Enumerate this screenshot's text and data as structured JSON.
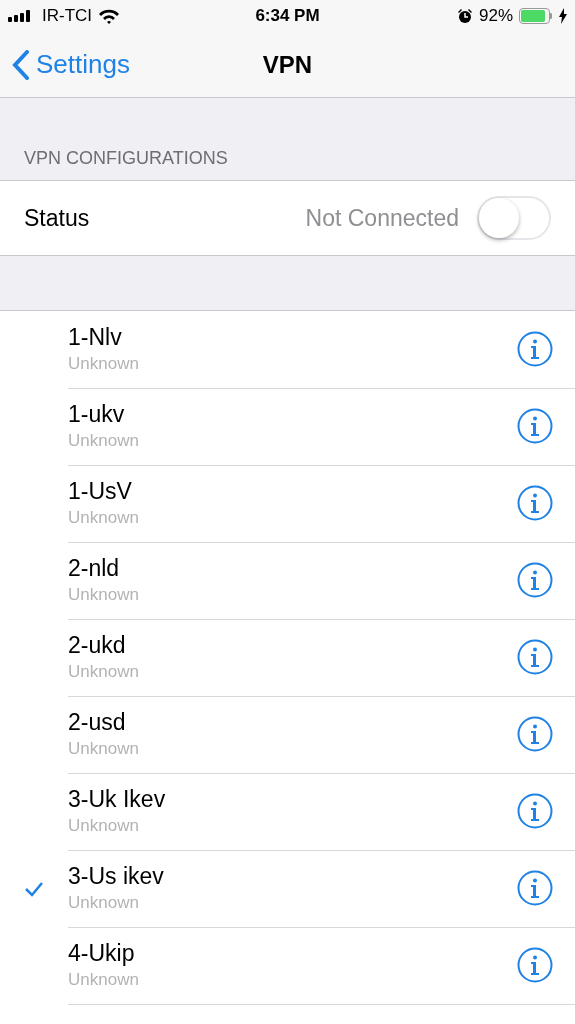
{
  "status_bar": {
    "carrier": "IR-TCI",
    "time": "6:34 PM",
    "battery_percent": "92%"
  },
  "nav_bar": {
    "back_label": "Settings",
    "title": "VPN"
  },
  "section_header": "VPN CONFIGURATIONS",
  "status": {
    "label": "Status",
    "value": "Not Connected",
    "on": false
  },
  "configurations": [
    {
      "name": "1-Nlv",
      "state": "Unknown",
      "selected": false
    },
    {
      "name": "1-ukv",
      "state": "Unknown",
      "selected": false
    },
    {
      "name": "1-UsV",
      "state": "Unknown",
      "selected": false
    },
    {
      "name": "2-nld",
      "state": "Unknown",
      "selected": false
    },
    {
      "name": "2-ukd",
      "state": "Unknown",
      "selected": false
    },
    {
      "name": "2-usd",
      "state": "Unknown",
      "selected": false
    },
    {
      "name": "3-Uk Ikev",
      "state": "Unknown",
      "selected": false
    },
    {
      "name": "3-Us ikev",
      "state": "Unknown",
      "selected": true
    },
    {
      "name": "4-Ukip",
      "state": "Unknown",
      "selected": false
    }
  ]
}
